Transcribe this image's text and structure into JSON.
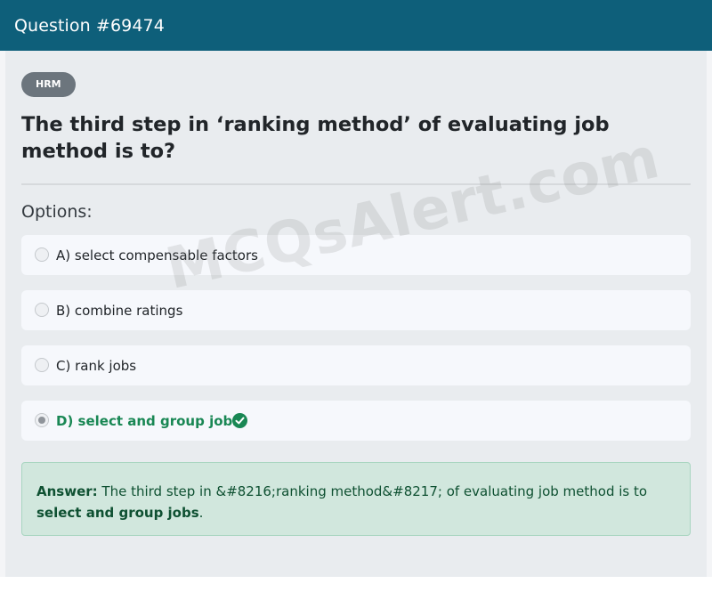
{
  "header": {
    "title": "Question #69474"
  },
  "badge": {
    "label": "HRM"
  },
  "question": {
    "text": "The third step in ‘ranking method’ of evaluating job method is to?"
  },
  "options_label": "Options:",
  "options": [
    {
      "label": "A) select compensable factors",
      "selected": false,
      "correct": false
    },
    {
      "label": "B) combine ratings",
      "selected": false,
      "correct": false
    },
    {
      "label": "C) rank jobs",
      "selected": false,
      "correct": false
    },
    {
      "label": "D) select and group jobs",
      "selected": true,
      "correct": true
    }
  ],
  "answer": {
    "prefix": "Answer:",
    "body": " The third step in &#8216;ranking method&#8217; of evaluating job method is to ",
    "highlight": "select and group jobs",
    "suffix": "."
  },
  "watermark": {
    "text": "MCQsAlert.com"
  },
  "colors": {
    "header_bg": "#0e5f7a",
    "correct": "#198754",
    "answer_bg": "#d1e7dd"
  },
  "icons": {
    "correct_mark": "check-circle-icon",
    "radio": "radio-icon"
  }
}
